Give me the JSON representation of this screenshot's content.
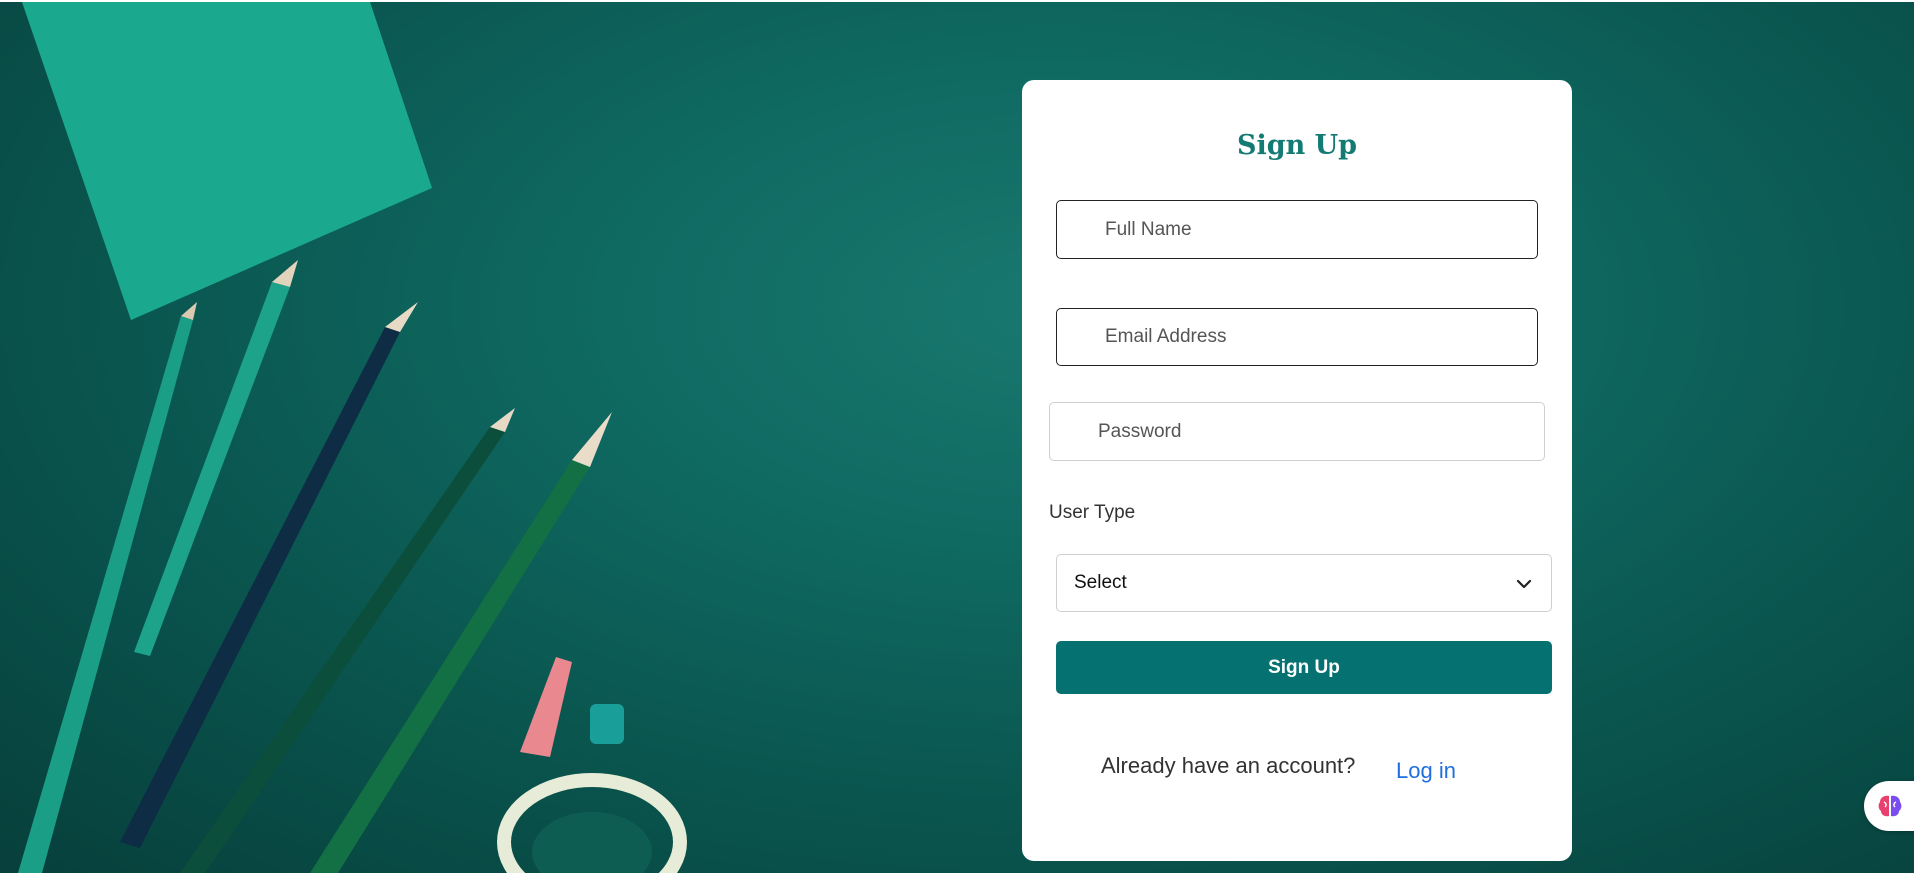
{
  "form": {
    "title": "Sign Up",
    "full_name_placeholder": "Full Name",
    "email_placeholder": "Email Address",
    "password_placeholder": "Password",
    "user_type_label": "User Type",
    "user_type_selected": "Select",
    "submit_label": "Sign Up",
    "already_text": "Already have an account?",
    "login_link": "Log in"
  },
  "icons": {
    "select_chevron": "chevron-down-icon",
    "floating_button": "brain-icon"
  },
  "colors": {
    "brand": "#067171",
    "title": "#137a74",
    "link": "#1f6fe0",
    "background": "#0f6a62"
  }
}
